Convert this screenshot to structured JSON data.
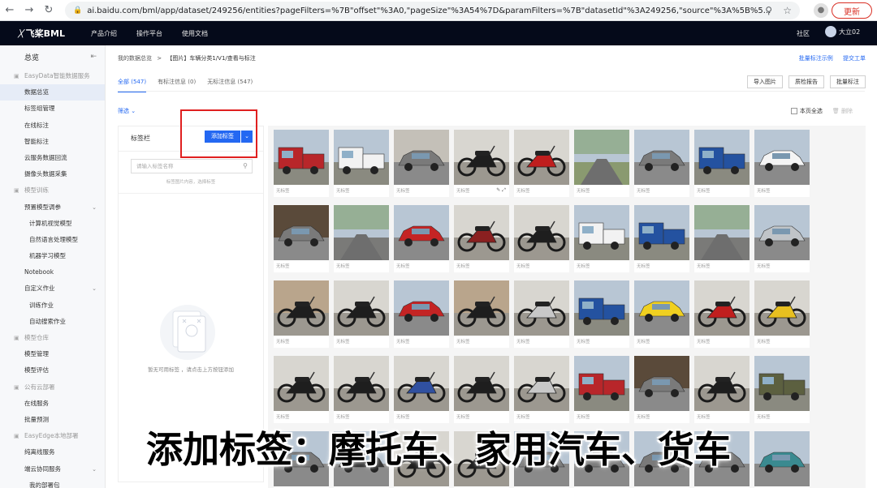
{
  "browser": {
    "url": "ai.baidu.com/bml/app/dataset/249256/entities?pageFilters=%7B\"offset\"%3A0,\"pageSize\"%3A54%7D&paramFilters=%7B\"datasetId\"%3A249256,\"source\"%3A%5B%5...",
    "update_label": "更新"
  },
  "topnav": {
    "logo": "飞桨BML",
    "menu": [
      "产品介绍",
      "操作平台",
      "使用文档"
    ],
    "community": "社区",
    "user": "大立02"
  },
  "sidebar": {
    "title": "总览",
    "items": [
      {
        "label": "EasyData智能数据服务",
        "kind": "group"
      },
      {
        "label": "数据总览",
        "kind": "item",
        "active": true
      },
      {
        "label": "标签组管理",
        "kind": "item"
      },
      {
        "label": "在线标注",
        "kind": "item"
      },
      {
        "label": "智能标注",
        "kind": "item"
      },
      {
        "label": "云服务数据回流",
        "kind": "item"
      },
      {
        "label": "摄像头数据采集",
        "kind": "item"
      },
      {
        "label": "模型训练",
        "kind": "group"
      },
      {
        "label": "预置模型调参",
        "kind": "item",
        "caret": true
      },
      {
        "label": "计算机视觉模型",
        "kind": "sub"
      },
      {
        "label": "自然语言处理模型",
        "kind": "sub"
      },
      {
        "label": "机器学习模型",
        "kind": "sub"
      },
      {
        "label": "Notebook",
        "kind": "item"
      },
      {
        "label": "自定义作业",
        "kind": "item",
        "caret": true
      },
      {
        "label": "训练作业",
        "kind": "sub"
      },
      {
        "label": "自动搜索作业",
        "kind": "sub"
      },
      {
        "label": "模型仓库",
        "kind": "group"
      },
      {
        "label": "模型管理",
        "kind": "item"
      },
      {
        "label": "模型评估",
        "kind": "item"
      },
      {
        "label": "公有云部署",
        "kind": "group"
      },
      {
        "label": "在线服务",
        "kind": "item"
      },
      {
        "label": "批量预测",
        "kind": "item"
      },
      {
        "label": "EasyEdge本地部署",
        "kind": "group"
      },
      {
        "label": "纯离线服务",
        "kind": "item"
      },
      {
        "label": "端云协同服务",
        "kind": "item",
        "caret": true
      },
      {
        "label": "我的部署包",
        "kind": "sub"
      }
    ]
  },
  "breadcrumb": {
    "root": "我的数据总览",
    "separator": ">",
    "current": "【图片】车辆分类1/V1/查看与标注"
  },
  "toplinks": [
    "批量标注示例",
    "提交工单"
  ],
  "tabs": [
    {
      "label": "全部 (547)",
      "active": true
    },
    {
      "label": "有标注信息 (0)",
      "active": false
    },
    {
      "label": "无标注信息 (547)",
      "active": false
    }
  ],
  "actions": [
    "导入图片",
    "质检报告",
    "批量标注"
  ],
  "filter_label": "筛选",
  "select_all_label": "本页全选",
  "delete_label": "删除",
  "label_panel": {
    "title": "标签栏",
    "add_button": "添加标签",
    "search_placeholder": "请输入标签名称",
    "hint": "标签图片内容，选择标签",
    "empty_text": "暂无可用标签 ，请点击上方按钮添加"
  },
  "image_grid": {
    "card_label": "无标签",
    "rows": [
      [
        "truck-red",
        "truck-white",
        "car-building",
        "motorcycle-black",
        "motorcycle-red",
        "field-empty",
        "car-parking",
        "pickup-blue",
        "car-white"
      ],
      [
        "car-garage",
        "road-trees",
        "car-red-street",
        "motorcycle-vintage",
        "motorcycle-dark",
        "van-white",
        "truck-blue",
        "road-view",
        "car-silver"
      ],
      [
        "motorcycle-street",
        "motorcycle-chopper",
        "beetle-red",
        "motorcycle-shop",
        "motorcycle-chrome",
        "pickup-blue-2",
        "car-yellow",
        "motorcycle-red-sport",
        "motorcycle-yellow"
      ],
      [
        "motorcycle-cruiser",
        "trike-white",
        "motorcycle-blue",
        "motorcycle-custom",
        "motorcycle-bw",
        "truck-red-cargo",
        "garage-cars",
        "motorcycle-touring",
        "truck-military"
      ],
      [
        "car-road",
        "car-dark",
        "motorcycle-part",
        "motorcycle-part2",
        "car-part",
        "car-part2",
        "car-part3",
        "car-part4",
        "car-teal"
      ]
    ]
  },
  "subtitle": "添加标签：摩托车、家用汽车、货车"
}
